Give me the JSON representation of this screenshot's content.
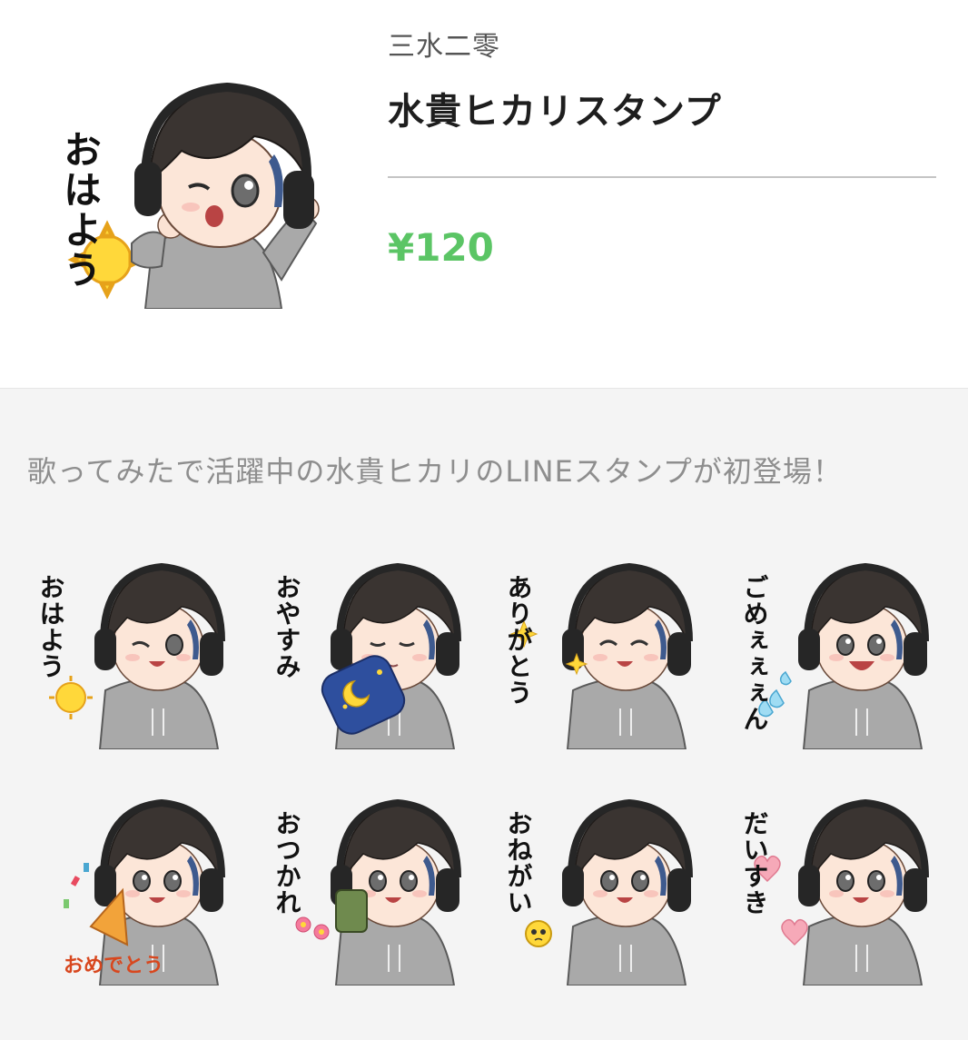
{
  "header": {
    "author": "三水二零",
    "title": "水貴ヒカリスタンプ",
    "price": "¥120",
    "main_sticker_text": "おはよう"
  },
  "description": "歌ってみたで活躍中の水貴ヒカリのLINEスタンプが初登場！",
  "stickers": [
    {
      "text": "おはよう",
      "prop": "sun"
    },
    {
      "text": "おやすみ",
      "prop": "pillow-moon"
    },
    {
      "text": "ありがとう",
      "prop": "sparkle"
    },
    {
      "text": "ごめぇぇぇん",
      "prop": "tears"
    },
    {
      "text": "おめでとう",
      "prop": "popper"
    },
    {
      "text": "おつかれ",
      "prop": "tea-flowers"
    },
    {
      "text": "おねがい",
      "prop": "emoji"
    },
    {
      "text": "だいすき",
      "prop": "hearts"
    }
  ],
  "colors": {
    "price": "#5bc565",
    "hair": "#3a3431",
    "hoodie": "#a7a7a7",
    "headphone": "#262626"
  }
}
